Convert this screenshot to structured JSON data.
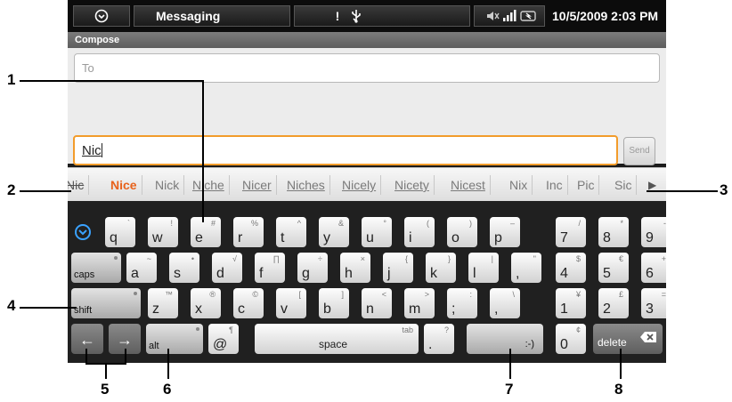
{
  "status_bar": {
    "app_title": "Messaging",
    "clock": "10/5/2009 2:03 PM"
  },
  "compose": {
    "header": "Compose",
    "to_placeholder": "To",
    "message_text": "Nic",
    "send_label": "Send"
  },
  "suggestions": [
    "Nic",
    "Nice",
    "Nick",
    "Niche",
    "Nicer",
    "Niches",
    "Nicely",
    "Nicety",
    "Nicest",
    "Nix",
    "Inc",
    "Pic",
    "Sic"
  ],
  "keyboard": {
    "row1": [
      {
        "ch": "q",
        "sub": "`"
      },
      {
        "ch": "w",
        "sub": "!"
      },
      {
        "ch": "e",
        "sub": "#"
      },
      {
        "ch": "r",
        "sub": "%"
      },
      {
        "ch": "t",
        "sub": "^"
      },
      {
        "ch": "y",
        "sub": "&"
      },
      {
        "ch": "u",
        "sub": "°"
      },
      {
        "ch": "i",
        "sub": "("
      },
      {
        "ch": "o",
        "sub": ")"
      },
      {
        "ch": "p",
        "sub": "–"
      },
      {
        "ch": "7",
        "sub": "/"
      },
      {
        "ch": "8",
        "sub": "*"
      },
      {
        "ch": "9",
        "sub": "-"
      }
    ],
    "row2": [
      {
        "ch": "a",
        "sub": "~"
      },
      {
        "ch": "s",
        "sub": "•"
      },
      {
        "ch": "d",
        "sub": "√"
      },
      {
        "ch": "f",
        "sub": "∏"
      },
      {
        "ch": "g",
        "sub": "÷"
      },
      {
        "ch": "h",
        "sub": "×"
      },
      {
        "ch": "j",
        "sub": "{"
      },
      {
        "ch": "k",
        "sub": "}"
      },
      {
        "ch": "l",
        "sub": "|"
      },
      {
        "ch": ",",
        "sub": "\""
      },
      {
        "ch": "4",
        "sub": "$"
      },
      {
        "ch": "5",
        "sub": "€"
      },
      {
        "ch": "6",
        "sub": "+"
      }
    ],
    "row3": [
      {
        "ch": "z",
        "sub": "™"
      },
      {
        "ch": "x",
        "sub": "®"
      },
      {
        "ch": "c",
        "sub": "©"
      },
      {
        "ch": "v",
        "sub": "["
      },
      {
        "ch": "b",
        "sub": "]"
      },
      {
        "ch": "n",
        "sub": "<"
      },
      {
        "ch": "m",
        "sub": ">"
      },
      {
        "ch": ";",
        "sub": ":"
      },
      {
        "ch": ",",
        "sub": "\\"
      },
      {
        "ch": "1",
        "sub": "¥"
      },
      {
        "ch": "2",
        "sub": "£"
      },
      {
        "ch": "3",
        "sub": "="
      }
    ],
    "caps_label": "caps",
    "shift_label": "shift",
    "alt_label": "alt",
    "at_label": "@",
    "at_sub": "¶",
    "space_label": "space",
    "space_sub": "tab",
    "period_label": ".",
    "period_sub": "?",
    "smiley_label": ":-)",
    "zero_label": "0",
    "zero_sub": "¢",
    "delete_label": "delete",
    "left_arrow": "←",
    "right_arrow": "→"
  },
  "callouts": [
    "1",
    "2",
    "3",
    "4",
    "5",
    "6",
    "7",
    "8"
  ],
  "colors": {
    "accent_orange": "#f29c2b",
    "suggestion_highlight": "#e8621c"
  }
}
